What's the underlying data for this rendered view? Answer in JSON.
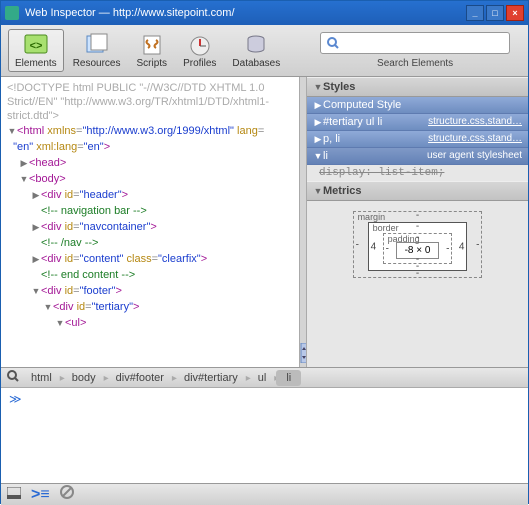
{
  "window": {
    "title": "Web Inspector — http://www.sitepoint.com/"
  },
  "toolbar": {
    "items": [
      {
        "label": "Elements"
      },
      {
        "label": "Resources"
      },
      {
        "label": "Scripts"
      },
      {
        "label": "Profiles"
      },
      {
        "label": "Databases"
      }
    ],
    "search_placeholder": "",
    "search_label": "Search Elements"
  },
  "doctype": "<!DOCTYPE html PUBLIC \"-//W3C//DTD XHTML 1.0 Strict//EN\" \"http://www.w3.org/TR/xhtml1/DTD/xhtml1-strict.dtd\">",
  "dom": {
    "html_open": "<html xmlns=\"http://www.w3.org/1999/xhtml\" lang=\"en\" xml:lang=\"en\">",
    "head": "<head>",
    "body": "<body>",
    "div_header": "<div id=\"header\">",
    "cmt_nav": "<!-- navigation bar -->",
    "div_navcontainer": "<div id=\"navcontainer\">",
    "cmt_navend": "<!-- /nav -->",
    "div_content": "<div id=\"content\" class=\"clearfix\">",
    "cmt_content_end": "<!-- end content -->",
    "div_footer": "<div id=\"footer\">",
    "div_tertiary": "<div id=\"tertiary\">",
    "ul": "<ul>"
  },
  "styles": {
    "header": "Styles",
    "rows": [
      {
        "selector": "Computed Style",
        "source": ""
      },
      {
        "selector": "#tertiary ul li",
        "source": "structure.css,stand…"
      },
      {
        "selector": "p, li",
        "source": "structure.css,stand…"
      },
      {
        "selector": "li",
        "source": "user agent stylesheet"
      }
    ],
    "rule": "display: list-item;"
  },
  "metrics": {
    "header": "Metrics",
    "margin": "margin",
    "border": "border",
    "padding": "padding",
    "content": "-8 × 0",
    "vals": {
      "m_t": "-",
      "m_b": "-",
      "m_l": "-",
      "m_r": "-",
      "b_t": "-",
      "b_b": "-",
      "b_l": "4",
      "b_r": "4",
      "p_t": "-",
      "p_b": "-",
      "p_l": "-",
      "p_r": "-"
    }
  },
  "breadcrumbs": [
    "html",
    "body",
    "div#footer",
    "div#tertiary",
    "ul",
    "li"
  ],
  "console_prompt": "≫"
}
